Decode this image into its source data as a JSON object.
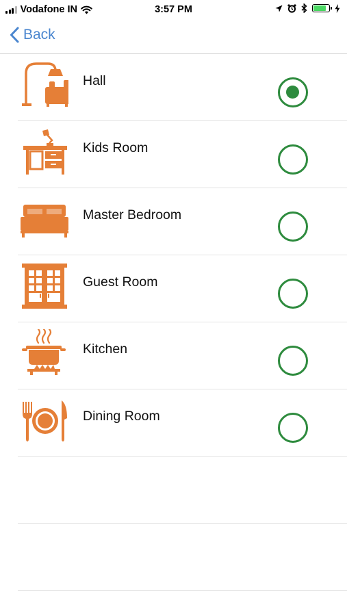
{
  "status_bar": {
    "carrier": "Vodafone IN",
    "time": "3:57 PM",
    "signal_bars_filled": 3,
    "signal_bars_total": 4,
    "battery_level": 0.85
  },
  "nav": {
    "back_label": "Back"
  },
  "colors": {
    "accent": "#4a86cf",
    "icon": "#e57f37",
    "radio": "#2e8b3e"
  },
  "rooms": [
    {
      "label": "Hall",
      "icon": "floor-lamp-armchair-icon",
      "selected": true
    },
    {
      "label": "Kids Room",
      "icon": "study-desk-lamp-icon",
      "selected": false
    },
    {
      "label": "Master Bedroom",
      "icon": "double-bed-icon",
      "selected": false
    },
    {
      "label": "Guest Room",
      "icon": "wardrobe-icon",
      "selected": false
    },
    {
      "label": "Kitchen",
      "icon": "cooking-pot-stove-icon",
      "selected": false
    },
    {
      "label": "Dining Room",
      "icon": "plate-fork-knife-icon",
      "selected": false
    }
  ]
}
